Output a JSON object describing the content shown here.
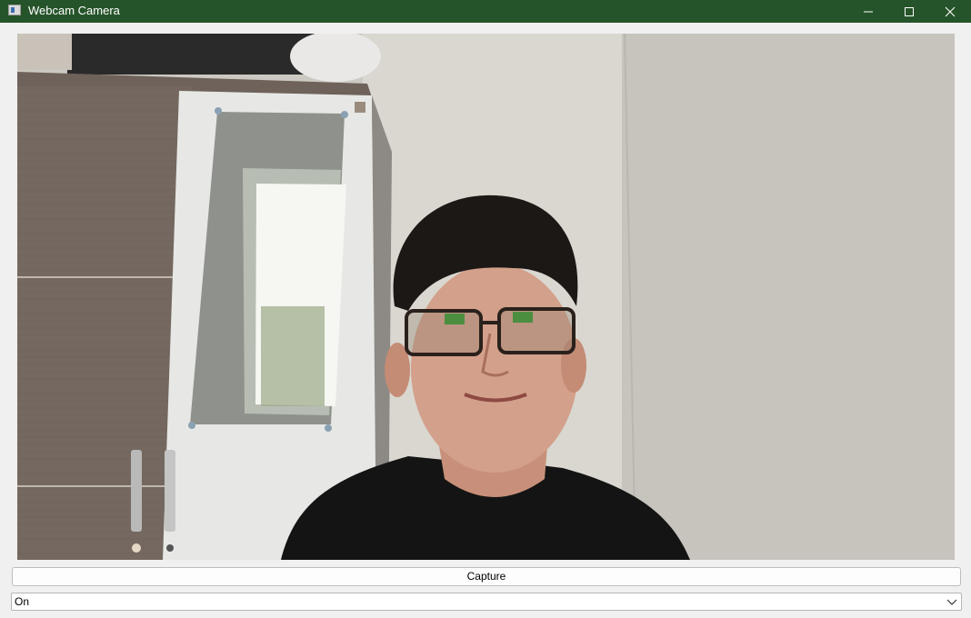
{
  "window": {
    "title": "Webcam Camera",
    "titlebar_color": "#26542a",
    "icons": {
      "app": "app-window-icon",
      "minimize": "minimize-icon",
      "maximize": "maximize-icon",
      "close": "close-icon"
    }
  },
  "video": {
    "description_icon": "webcam-feed"
  },
  "controls": {
    "capture_label": "Capture",
    "mode_value": "On"
  }
}
